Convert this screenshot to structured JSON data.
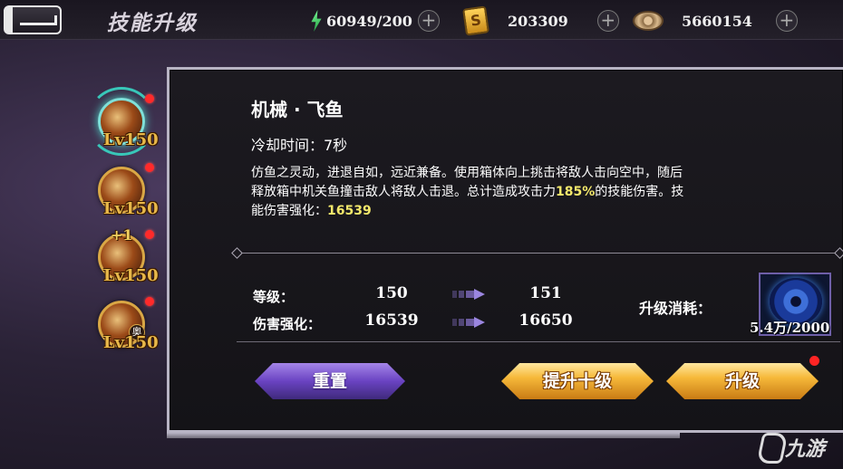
{
  "header": {
    "title": "技能升级",
    "resources": [
      {
        "name": "energy",
        "icon": "lightning-icon",
        "value": "60949/200"
      },
      {
        "name": "gold",
        "icon": "gold-card-icon",
        "value": "203309"
      },
      {
        "name": "coin",
        "icon": "coin-icon",
        "value": "5660154"
      }
    ],
    "plus_label": "+"
  },
  "skills": [
    {
      "level": "Lv150",
      "selected": true,
      "badge": ""
    },
    {
      "level": "Lv150",
      "selected": false,
      "badge": ""
    },
    {
      "level": "Lv150",
      "selected": false,
      "badge": "",
      "bonus": "+1"
    },
    {
      "level": "Lv150",
      "selected": false,
      "badge": "奥"
    }
  ],
  "detail": {
    "name": "机械 · 飞鱼",
    "cooldown": "冷却时间：7秒",
    "desc_line1": "仿鱼之灵动，进退自如，远近兼备。使用箱体向上挑击将敌人击向空中，随后",
    "desc_line2_a": "释放箱中机关鱼撞击敌人将敌人击退。总计造成攻击力",
    "desc_line2_hl": "185%",
    "desc_line2_b": "的技能伤害。技",
    "desc_line3_a": "能伤害强化：",
    "desc_line3_hl": "16539"
  },
  "stats": {
    "level_label": "等级：",
    "level_from": "150",
    "level_to": "151",
    "damage_label": "伤害强化：",
    "damage_from": "16539",
    "damage_to": "16650"
  },
  "cost": {
    "label": "升级消耗：",
    "count": "5.4万/2000"
  },
  "buttons": {
    "reset": "重置",
    "upgrade_ten": "提升十级",
    "upgrade": "升级"
  },
  "watermark": "九游",
  "colors": {
    "highlight": "#f3e86b",
    "level_text": "#e8b84a",
    "reset_button": "#6a43c2",
    "gold_button": "#f6b93a",
    "notify_dot": "#ff2424"
  }
}
